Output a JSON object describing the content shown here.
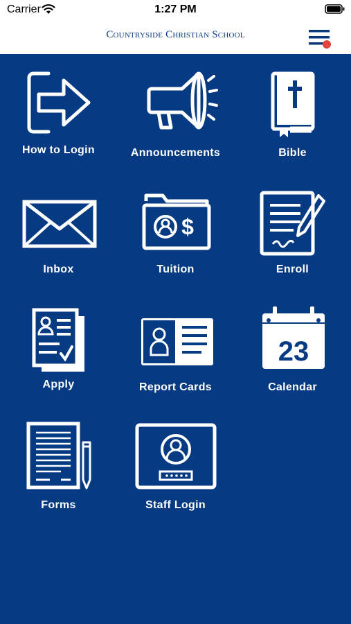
{
  "status_bar": {
    "carrier": "Carrier",
    "time": "1:27 PM"
  },
  "header": {
    "school_name": "Countryside Christian School",
    "notification_color": "#e2443e"
  },
  "colors": {
    "background": "#063b83",
    "icon": "#ffffff",
    "brand": "#0b3a7c"
  },
  "tiles": [
    {
      "label": "How to Login",
      "icon": "login-arrow-icon"
    },
    {
      "label": "Announcements",
      "icon": "megaphone-icon"
    },
    {
      "label": "Bible",
      "icon": "bible-icon"
    },
    {
      "label": "Inbox",
      "icon": "envelope-icon"
    },
    {
      "label": "Tuition",
      "icon": "tuition-folder-icon"
    },
    {
      "label": "Enroll",
      "icon": "enroll-document-icon"
    },
    {
      "label": "Apply",
      "icon": "application-form-icon"
    },
    {
      "label": "Report Cards",
      "icon": "report-card-icon"
    },
    {
      "label": "Calendar",
      "icon": "calendar-icon",
      "date_number": "23"
    },
    {
      "label": "Forms",
      "icon": "forms-pencil-icon"
    },
    {
      "label": "Staff Login",
      "icon": "staff-login-icon"
    }
  ]
}
